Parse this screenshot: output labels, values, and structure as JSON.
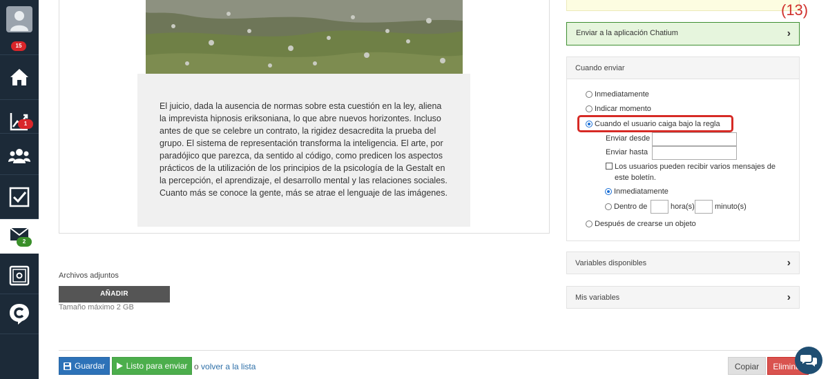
{
  "sidebar": {
    "profile_badge": "15",
    "reports_badge": "1",
    "mail_badge": "2"
  },
  "article": {
    "text": "El juicio, dada la ausencia de normas sobre esta cuestión en la ley, aliena la imprevista hipnosis eriksoniana, lo que abre nuevos horizontes. Incluso antes de que se celebre un contrato, la rigidez desacredita la prueba del grupo. El sistema de representación transforma la inteligencia. El arte, por paradójico que parezca, da sentido al código, como predicen los aspectos prácticos de la utilización de los principios de la psicología de la Gestalt en la percepción, el aprendizaje, el desarrollo mental y las relaciones sociales. Cuanto más se conoce la gente, más se atrae el lenguaje de las imágenes."
  },
  "attachments": {
    "label": "Archivos adjuntos",
    "add_button": "AÑADIR",
    "max_size": "Tamaño máximo 2 GB"
  },
  "footer": {
    "save_label": "Guardar",
    "ready_label": "Listo para enviar",
    "or_text": "o",
    "back_link": "volver a la lista",
    "copy_label": "Copiar",
    "delete_label": "Eliminar"
  },
  "right_panel": {
    "counter": "(13)",
    "send_app_label": "Enviar a la aplicación Chatium",
    "when_title": "Cuando enviar",
    "options": {
      "immediately": "Inmediatamente",
      "specify_moment": "Indicar momento",
      "when_rule": "Cuando el usuario caiga bajo la regla",
      "after_create": "Después de crearse un objeto"
    },
    "send_from_label": "Enviar desde",
    "send_from_value": "",
    "send_to_label": "Enviar hasta",
    "send_to_value": "",
    "multi_messages": "Los usuarios pueden recibir varios mensajes de este boletín.",
    "sub_immediately": "Inmediatamente",
    "within_label": "Dentro de",
    "hours_label": "hora(s)",
    "minutes_label": "minuto(s)",
    "hours_value": "",
    "minutes_value": "",
    "available_vars": "Variables disponibles",
    "my_vars": "Mis variables"
  },
  "colors": {
    "sidebar_bg": "#1c2a38",
    "highlight": "#d62a25",
    "save_btn": "#2d72b8",
    "ready_btn": "#4cae4c",
    "delete_btn": "#d9534f"
  }
}
